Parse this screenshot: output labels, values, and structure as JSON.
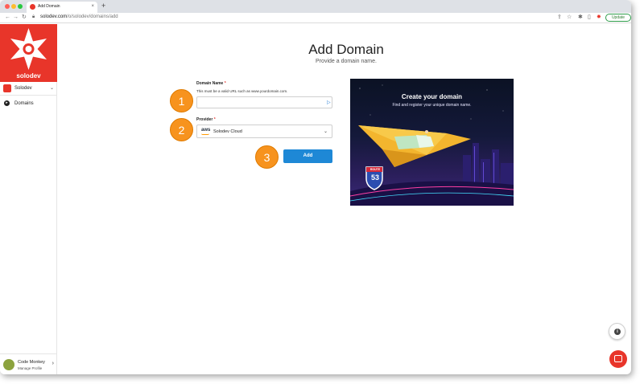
{
  "browser": {
    "tab_title": "Add Domain",
    "tab_close": "×",
    "new_tab": "+",
    "url_host": "solodev.com",
    "url_path": "/o/solodev/domains/add",
    "update_label": "Update"
  },
  "sidebar": {
    "brand_name": "solodev",
    "org_name": "Solodev",
    "nav_items": [
      {
        "label": "Domains",
        "icon": "domain-icon"
      }
    ],
    "profile": {
      "name": "Code Monkey",
      "link": "Manage Profile"
    }
  },
  "main": {
    "title": "Add Domain",
    "subtitle": "Provide a domain name.",
    "domain_field": {
      "label": "Domain Name",
      "required_mark": "*",
      "helper": "This must be a valid URL such as www.yourdomain.com.",
      "value": ""
    },
    "provider_field": {
      "label": "Provider",
      "required_mark": "*",
      "logo_text": "aws",
      "value": "Solodev Cloud"
    },
    "add_button": "Add",
    "steps": [
      "1",
      "2",
      "3"
    ]
  },
  "hero": {
    "title": "Create your domain",
    "subtitle": "Find and register your unique domain name.",
    "route_label": "ROUTE",
    "route_number": "53"
  },
  "colors": {
    "brand": "#e8352a",
    "accent": "#1e88d6",
    "step": "#f7931e"
  }
}
